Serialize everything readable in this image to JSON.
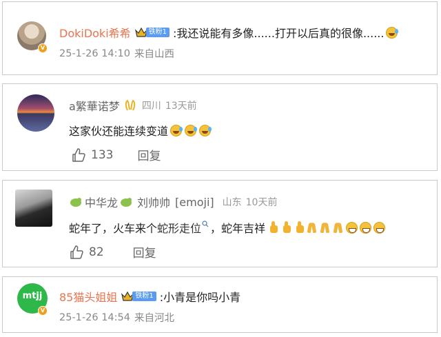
{
  "comments": [
    {
      "user": "DokiDoki希希",
      "fan_badge": "铁粉1",
      "text": ":我还说能有多像......打开以后真的很像......",
      "time": "25-1-26 14:10",
      "location": "来自山西"
    },
    {
      "user": "a繁華诺梦",
      "location": "四川",
      "time": "13天前",
      "text": "这家伙还能连续变道",
      "likes": "133",
      "reply_label": "回复"
    },
    {
      "user_a": "中华龙",
      "user_b": "刘帅帅",
      "emoji_tag": "[emoji]",
      "location": "山东",
      "time": "10天前",
      "text_prefix": "蛇年了，火车来个",
      "link_text": "蛇形走位",
      "text_suffix": "，蛇年吉祥",
      "likes": "82",
      "reply_label": "回复"
    },
    {
      "user": "85猫头姐姐",
      "fan_badge": "铁粉1",
      "avatar_text": "mtjj",
      "text": ":小青是你吗小青",
      "time": "25-1-26 14:54",
      "location": "来自河北"
    }
  ],
  "colors": {
    "username_accent": "#eb7350",
    "fan_badge": "#5b9cf0",
    "verified_badge": "#f0a020",
    "avatar_mtjj_bg": "#2fb84a"
  }
}
